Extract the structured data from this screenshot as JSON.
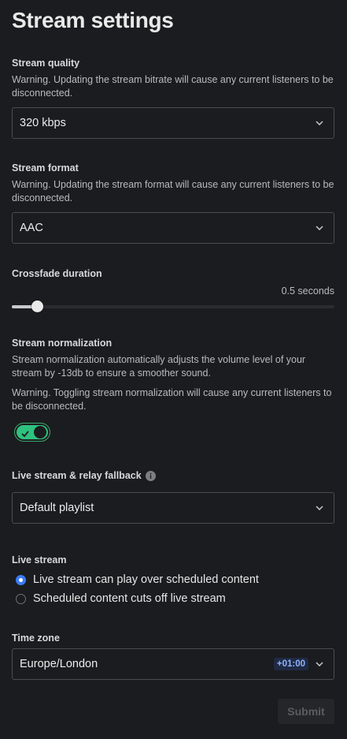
{
  "page": {
    "title": "Stream settings"
  },
  "stream_quality": {
    "label": "Stream quality",
    "warning": "Warning. Updating the stream bitrate will cause any current listeners to be disconnected.",
    "selected": "320 kbps"
  },
  "stream_format": {
    "label": "Stream format",
    "warning": "Warning. Updating the stream format will cause any current listeners to be disconnected.",
    "selected": "AAC"
  },
  "crossfade": {
    "label": "Crossfade duration",
    "value_text": "0.5 seconds",
    "level_fraction": 0.077
  },
  "normalization": {
    "label": "Stream normalization",
    "description": "Stream normalization automatically adjusts the volume level of your stream by -13db to ensure a smoother sound.",
    "warning": "Warning. Toggling stream normalization will cause any current listeners to be disconnected.",
    "enabled": true
  },
  "fallback": {
    "label": "Live stream & relay fallback",
    "selected": "Default playlist"
  },
  "live_stream": {
    "label": "Live stream",
    "options": [
      {
        "label": "Live stream can play over scheduled content",
        "checked": true
      },
      {
        "label": "Scheduled content cuts off live stream",
        "checked": false
      }
    ]
  },
  "time_zone": {
    "label": "Time zone",
    "selected": "Europe/London",
    "offset": "+01:00"
  },
  "actions": {
    "submit_label": "Submit"
  },
  "colors": {
    "background": "#1b1c1f",
    "toggle_on": "#2ec27e",
    "radio_accent": "#3d7cf2",
    "badge_text": "#8fb3ff"
  },
  "icons": {
    "select_chevron": "chevron-down-icon",
    "info": "info-icon",
    "toggle_check": "check-icon"
  }
}
